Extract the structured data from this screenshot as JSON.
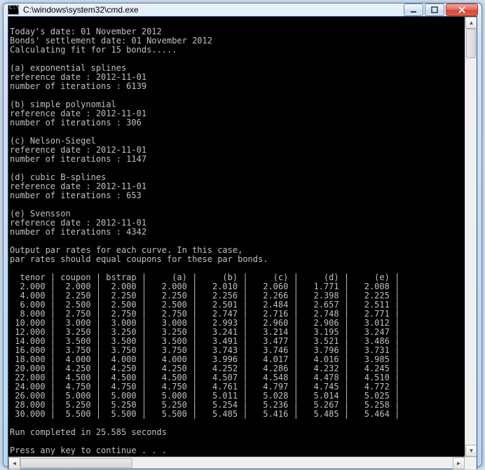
{
  "window": {
    "title": "C:\\windows\\system32\\cmd.exe"
  },
  "console": {
    "intro": [
      "",
      "Today's date: 01 November 2012",
      "Bonds' settlement date: 01 November 2012",
      "Calculating fit for 15 bonds....."
    ],
    "methods": [
      {
        "tag": "(a)",
        "name": "exponential splines",
        "ref_date": "2012-11-01",
        "iterations": 6139
      },
      {
        "tag": "(b)",
        "name": "simple polynomial",
        "ref_date": "2012-11-01",
        "iterations": 306
      },
      {
        "tag": "(c)",
        "name": "Nelson-Siegel",
        "ref_date": "2012-11-01",
        "iterations": 1147
      },
      {
        "tag": "(d)",
        "name": "cubic B-splines",
        "ref_date": "2012-11-01",
        "iterations": 653
      },
      {
        "tag": "(e)",
        "name": "Svensson",
        "ref_date": "2012-11-01",
        "iterations": 4342
      }
    ],
    "output_heading": [
      "Output par rates for each curve. In this case,",
      "par rates should equal coupons for these par bonds."
    ],
    "table": {
      "columns": [
        "tenor",
        "coupon",
        "bstrap",
        "(a)",
        "(b)",
        "(c)",
        "(d)",
        "(e)"
      ],
      "rows": [
        [
          2.0,
          2.0,
          2.0,
          2.0,
          2.01,
          2.06,
          1.771,
          2.008
        ],
        [
          4.0,
          2.25,
          2.25,
          2.25,
          2.256,
          2.266,
          2.398,
          2.225
        ],
        [
          6.0,
          2.5,
          2.5,
          2.5,
          2.501,
          2.484,
          2.657,
          2.511
        ],
        [
          8.0,
          2.75,
          2.75,
          2.75,
          2.747,
          2.716,
          2.748,
          2.771
        ],
        [
          10.0,
          3.0,
          3.0,
          3.0,
          2.993,
          2.96,
          2.906,
          3.012
        ],
        [
          12.0,
          3.25,
          3.25,
          3.25,
          3.241,
          3.214,
          3.195,
          3.247
        ],
        [
          14.0,
          3.5,
          3.5,
          3.5,
          3.491,
          3.477,
          3.521,
          3.486
        ],
        [
          16.0,
          3.75,
          3.75,
          3.75,
          3.743,
          3.746,
          3.796,
          3.731
        ],
        [
          18.0,
          4.0,
          4.0,
          4.0,
          3.996,
          4.017,
          4.016,
          3.985
        ],
        [
          20.0,
          4.25,
          4.25,
          4.25,
          4.252,
          4.286,
          4.232,
          4.245
        ],
        [
          22.0,
          4.5,
          4.5,
          4.5,
          4.507,
          4.548,
          4.478,
          4.51
        ],
        [
          24.0,
          4.75,
          4.75,
          4.75,
          4.761,
          4.797,
          4.745,
          4.772
        ],
        [
          26.0,
          5.0,
          5.0,
          5.0,
          5.011,
          5.028,
          5.014,
          5.025
        ],
        [
          28.0,
          5.25,
          5.25,
          5.25,
          5.254,
          5.236,
          5.267,
          5.258
        ],
        [
          30.0,
          5.5,
          5.5,
          5.5,
          5.485,
          5.416,
          5.485,
          5.464
        ]
      ]
    },
    "footer": {
      "runtime_line": "Run completed in 25.585 seconds",
      "runtime_seconds": 25.585,
      "prompt": "Press any key to continue . . ."
    }
  },
  "chart_data": {
    "type": "table",
    "title": "Output par rates for each curve",
    "columns": [
      "tenor",
      "coupon",
      "bstrap",
      "(a)",
      "(b)",
      "(c)",
      "(d)",
      "(e)"
    ],
    "rows": [
      [
        2.0,
        2.0,
        2.0,
        2.0,
        2.01,
        2.06,
        1.771,
        2.008
      ],
      [
        4.0,
        2.25,
        2.25,
        2.25,
        2.256,
        2.266,
        2.398,
        2.225
      ],
      [
        6.0,
        2.5,
        2.5,
        2.5,
        2.501,
        2.484,
        2.657,
        2.511
      ],
      [
        8.0,
        2.75,
        2.75,
        2.75,
        2.747,
        2.716,
        2.748,
        2.771
      ],
      [
        10.0,
        3.0,
        3.0,
        3.0,
        2.993,
        2.96,
        2.906,
        3.012
      ],
      [
        12.0,
        3.25,
        3.25,
        3.25,
        3.241,
        3.214,
        3.195,
        3.247
      ],
      [
        14.0,
        3.5,
        3.5,
        3.5,
        3.491,
        3.477,
        3.521,
        3.486
      ],
      [
        16.0,
        3.75,
        3.75,
        3.75,
        3.743,
        3.746,
        3.796,
        3.731
      ],
      [
        18.0,
        4.0,
        4.0,
        4.0,
        3.996,
        4.017,
        4.016,
        3.985
      ],
      [
        20.0,
        4.25,
        4.25,
        4.25,
        4.252,
        4.286,
        4.232,
        4.245
      ],
      [
        22.0,
        4.5,
        4.5,
        4.5,
        4.507,
        4.548,
        4.478,
        4.51
      ],
      [
        24.0,
        4.75,
        4.75,
        4.75,
        4.761,
        4.797,
        4.745,
        4.772
      ],
      [
        26.0,
        5.0,
        5.0,
        5.0,
        5.011,
        5.028,
        5.014,
        5.025
      ],
      [
        28.0,
        5.25,
        5.25,
        5.25,
        5.254,
        5.236,
        5.267,
        5.258
      ],
      [
        30.0,
        5.5,
        5.5,
        5.5,
        5.485,
        5.416,
        5.485,
        5.464
      ]
    ]
  }
}
